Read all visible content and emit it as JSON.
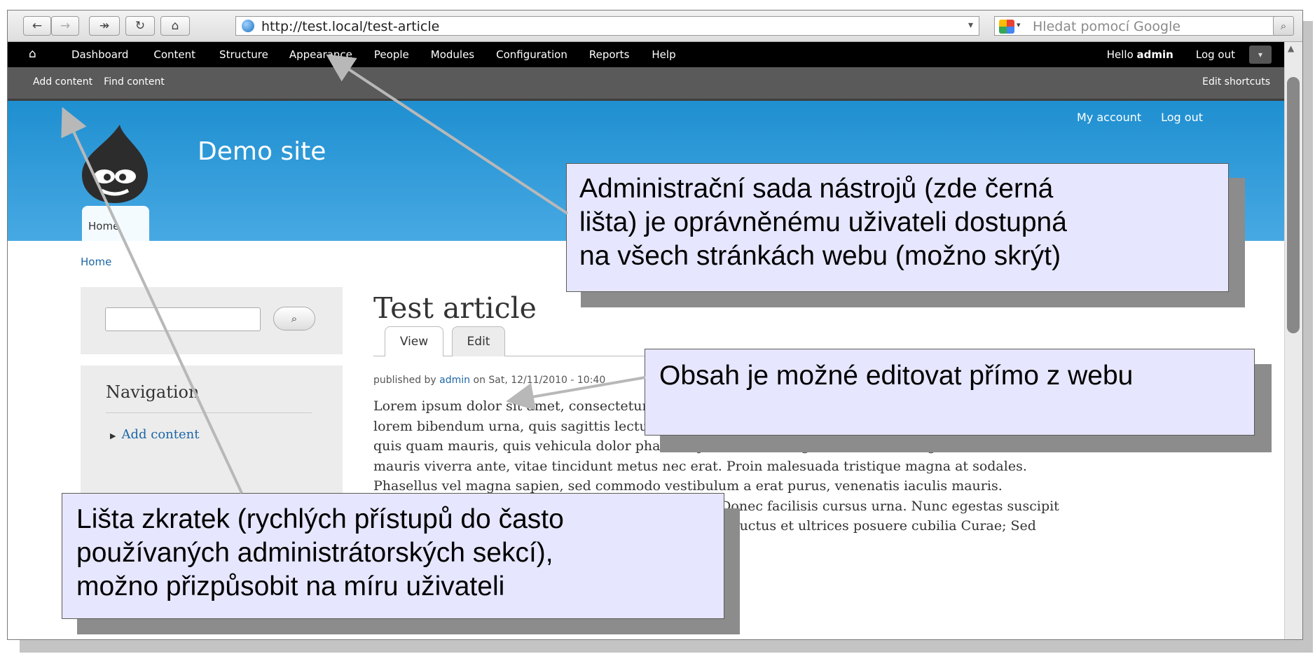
{
  "browser": {
    "url": "http://test.local/test-article",
    "search_placeholder": "Hledat pomocí Google"
  },
  "admin_toolbar": {
    "menu": [
      "Dashboard",
      "Content",
      "Structure",
      "Appearance",
      "People",
      "Modules",
      "Configuration",
      "Reports",
      "Help"
    ],
    "greeting_prefix": "Hello ",
    "user": "admin",
    "logout": "Log out"
  },
  "shortcuts": {
    "items": [
      "Add content",
      "Find content"
    ],
    "edit": "Edit shortcuts"
  },
  "site": {
    "name": "Demo site",
    "links": [
      "My account",
      "Log out"
    ],
    "home_tab": "Home",
    "breadcrumb": "Home"
  },
  "sidebar": {
    "nav_title": "Navigation",
    "nav_items": [
      "Add content"
    ]
  },
  "article": {
    "title": "Test article",
    "tabs": [
      "View",
      "Edit"
    ],
    "published_prefix": "published by ",
    "author": "admin",
    "published_suffix": " on Sat, 12/11/2010 - 10:40",
    "body_lines": [
      "Lorem ipsum dolor sit amet, consectetur adipiscing elit. In tempor, diam in euismod egestas, tellus",
      "lorem bibendum urna, quis sagittis lectus libero nec elit. Ut tincidunt congue mi in lobortis. Praesent",
      "quis quam mauris, quis vehicula dolor pharetra justo. Donec sagittis, dolor ac fringilla cursus, nulla",
      "mauris viverra ante, vitae tincidunt metus nec erat. Proin malesuada tristique magna at sodales.",
      "Phasellus vel magna sapien, sed commodo vestibulum a erat purus, venenatis iaculis mauris.",
      "Maecenas nec libero lorem, vel posuere dignissim. Donec facilisis cursus urna. Nunc egestas suscipit",
      "lorem. Vestibulum ante ipsum primis in faucibus orci luctus et ultrices posuere cubilia Curae; Sed"
    ]
  },
  "callouts": {
    "toolbar": [
      "Administrační sada nástrojů (zde černá",
      "lišta) je oprávněnému uživateli dostupná",
      "na všech stránkách webu (možno skrýt)"
    ],
    "edit": [
      "Obsah je možné editovat přímo z webu"
    ],
    "shortcuts": [
      "Lišta zkratek (rychlých přístupů do často",
      "používaných administrátorských sekcí),",
      "možno přizpůsobit na míru uživateli"
    ],
    "fill_color": "#e6e6ff"
  }
}
